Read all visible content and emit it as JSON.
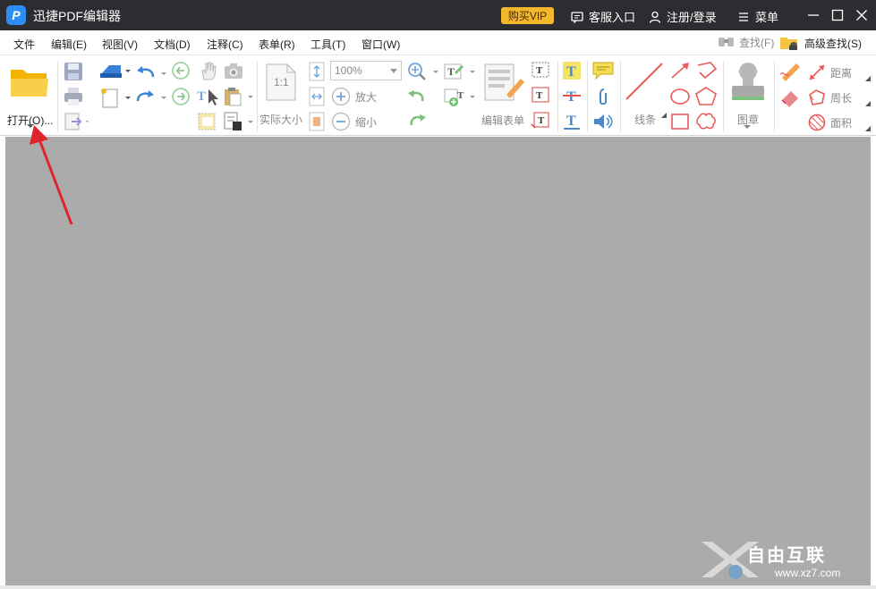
{
  "app": {
    "logo_letter": "P",
    "title": "迅捷PDF编辑器"
  },
  "titlebar": {
    "vip_label": "购买VIP",
    "support_label": "客服入口",
    "login_label": "注册/登录",
    "menu_label": "菜单"
  },
  "menubar": {
    "items": [
      "文件",
      "编辑(E)",
      "视图(V)",
      "文档(D)",
      "注释(C)",
      "表单(R)",
      "工具(T)",
      "窗口(W)"
    ],
    "find_label": "查找(F)",
    "advanced_find_label": "高级查找(S)"
  },
  "ribbon": {
    "open_label": "打开(O)...",
    "actual_size_label": "实际大小",
    "zoom_value": "100%",
    "zoom_in_label": "放大",
    "zoom_out_label": "缩小",
    "edit_form_label": "编辑表单",
    "lines_label": "线条",
    "stamp_label": "图章",
    "distance_label": "距离",
    "perimeter_label": "周长",
    "area_label": "面积",
    "actual_size_icon_text": "1:1"
  },
  "watermark": {
    "text": "自由互联",
    "url": "www.xz7.com"
  },
  "colors": {
    "titlebar": "#2b2d30",
    "vip": "#f2b72b",
    "workspace": "#ababab",
    "annotation_red": "#e0242b",
    "logo": "#2c8df6"
  }
}
